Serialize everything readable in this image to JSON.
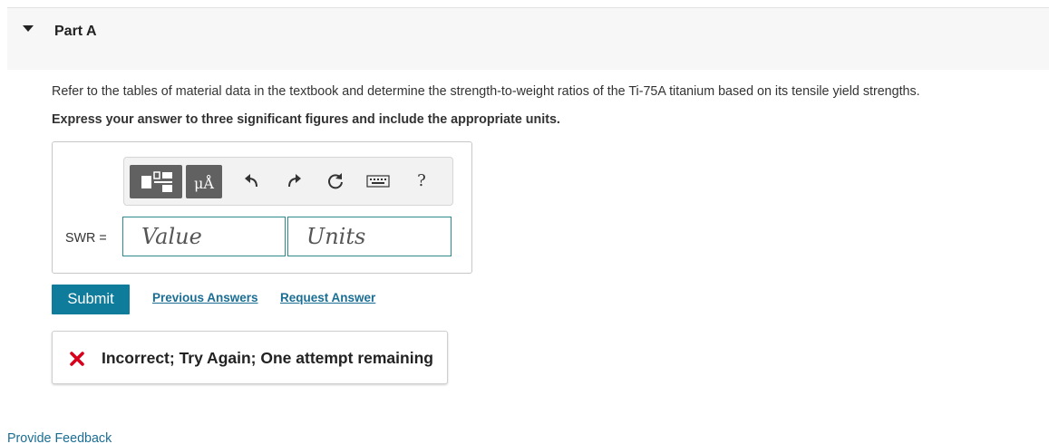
{
  "part": {
    "title": "Part A"
  },
  "question": {
    "text": "Refer to the tables of material data in the textbook and determine the strength-to-weight ratios of the Ti-75A titanium based on its tensile yield strengths.",
    "instruction": "Express your answer to three significant figures and include the appropriate units."
  },
  "answer": {
    "label": "SWR =",
    "value_placeholder": "Value",
    "units_placeholder": "Units",
    "toolbar": {
      "units_button_label": "μÅ",
      "help_label": "?",
      "icons": [
        "templates-icon",
        "units-icon",
        "undo-icon",
        "redo-icon",
        "reset-icon",
        "keyboard-icon",
        "help-icon"
      ]
    }
  },
  "actions": {
    "submit_label": "Submit",
    "previous_answers_label": "Previous Answers",
    "request_answer_label": "Request Answer"
  },
  "feedback": {
    "message": "Incorrect; Try Again; One attempt remaining",
    "status_color": "#d9001b"
  },
  "footer": {
    "provide_feedback_label": "Provide Feedback"
  },
  "colors": {
    "accent": "#0f7c9b",
    "link": "#1a6e94",
    "input_border": "#2e8b8b"
  }
}
